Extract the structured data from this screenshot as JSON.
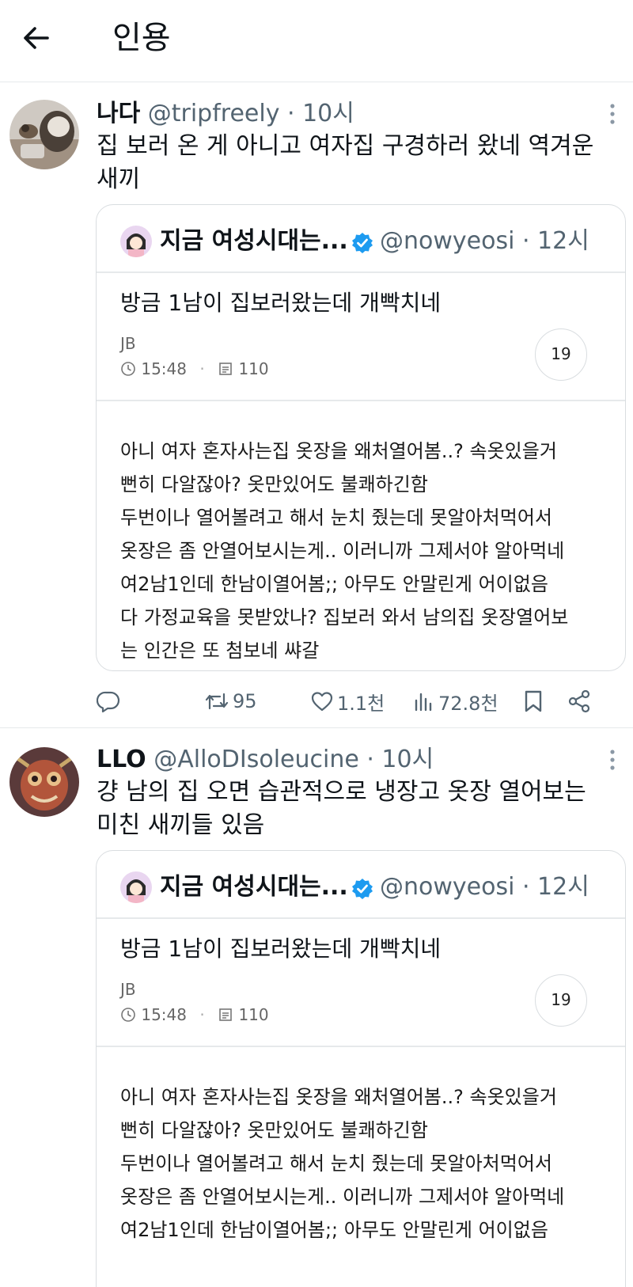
{
  "header": {
    "title": "인용",
    "back_icon": "arrow-left-icon"
  },
  "posts": [
    {
      "name": "나다",
      "meta": "@tripfreely · 10시",
      "text": "집 보러 온 게 아니고 여자집 구경하러 왔네 역겨운 새끼",
      "quote": {
        "name": "지금 여성시대는...",
        "meta": "@nowyeosi · 12시",
        "title": "방금 1남이 집보러왔는데 개빡치네",
        "author": "JB",
        "time": "15:48",
        "views": "110",
        "count": "19",
        "body": [
          "아니 여자 혼자사는집 옷장을 왜처열어봄..? 속옷있을거",
          "뻔히 다알잖아? 옷만있어도 불쾌하긴함",
          "두번이나 열어볼려고 해서 눈치 줬는데 못알아처먹어서",
          "옷장은 좀 안열어보시는게.. 이러니까 그제서야 알아먹네",
          "여2남1인데 한남이열어봄;; 아무도 안말린게 어이없음",
          "다 가정교육을 못받았나? 집보러 와서 남의집 옷장열어보",
          "는 인간은 또 첨보네 쌰갈"
        ]
      },
      "actions": {
        "retweets": "95",
        "likes": "1.1천",
        "views": "72.8천"
      }
    },
    {
      "name": "LLO",
      "meta": "@AlloDIsoleucine · 10시",
      "text": "걍 남의 집 오면 습관적으로 냉장고 옷장 열어보는 미친 새끼들 있음",
      "quote": {
        "name": "지금 여성시대는...",
        "meta": "@nowyeosi · 12시",
        "title": "방금 1남이 집보러왔는데 개빡치네",
        "author": "JB",
        "time": "15:48",
        "views": "110",
        "count": "19",
        "body": [
          "아니 여자 혼자사는집 옷장을 왜처열어봄..? 속옷있을거",
          "뻔히 다알잖아? 옷만있어도 불쾌하긴함",
          "두번이나 열어볼려고 해서 눈치 줬는데 못알아처먹어서",
          "옷장은 좀 안열어보시는게.. 이러니까 그제서야 알아먹네",
          "여2남1인데 한남이열어봄;; 아무도 안말린게 어이없음"
        ]
      }
    }
  ],
  "colors": {
    "text": "#0f1419",
    "muted": "#536471",
    "verified": "#1d9bf0",
    "border": "#d9dde0"
  },
  "icons": [
    "arrow-left-icon",
    "more-vertical-icon",
    "verified-icon",
    "clock-icon",
    "document-icon",
    "reply-icon",
    "retweet-icon",
    "heart-icon",
    "views-icon",
    "bookmark-icon",
    "share-icon"
  ]
}
